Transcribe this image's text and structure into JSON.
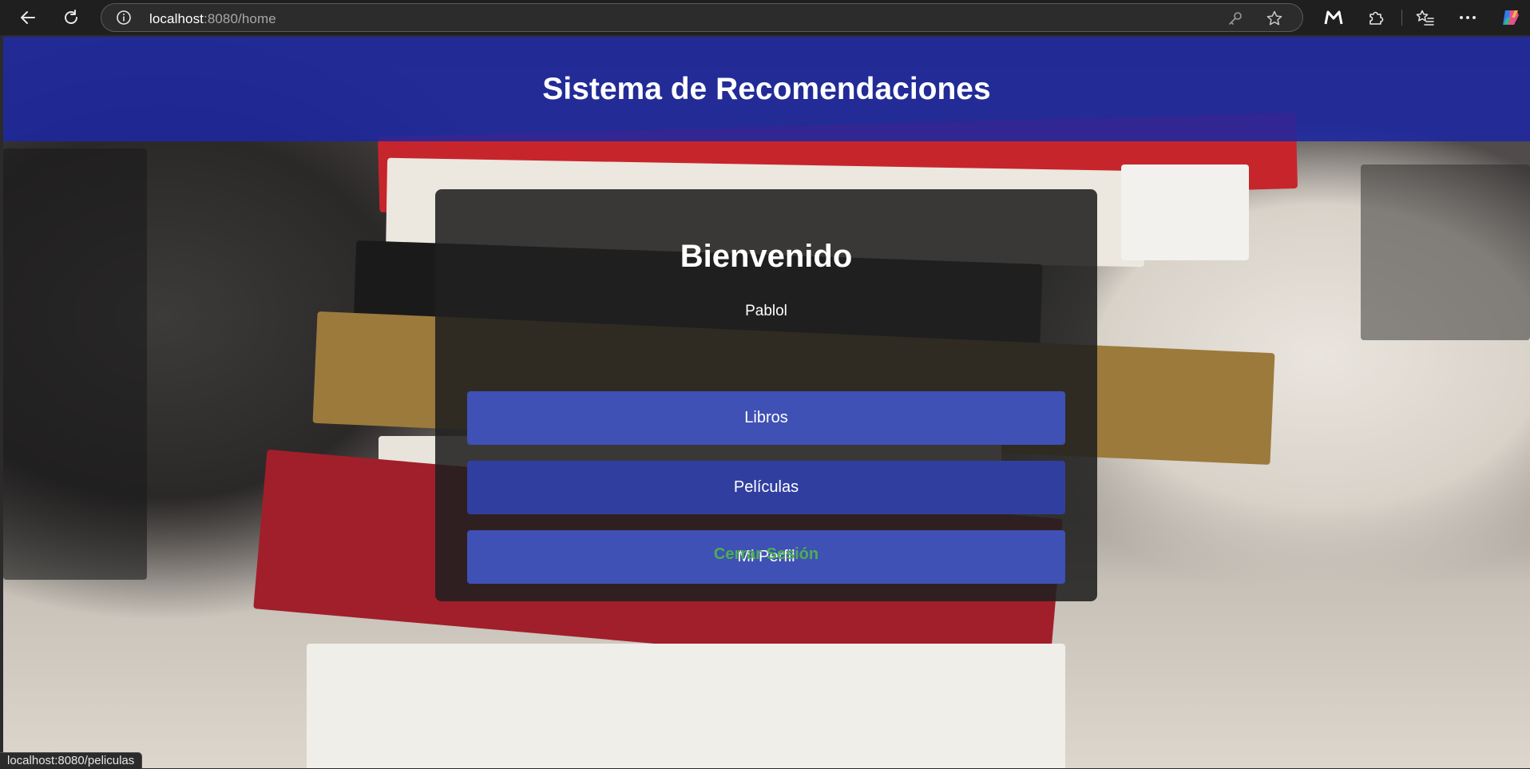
{
  "browser": {
    "url_host": "localhost",
    "url_path": ":8080/home",
    "status_url": "localhost:8080/peliculas"
  },
  "header": {
    "title": "Sistema de Recomendaciones"
  },
  "card": {
    "welcome": "Bienvenido",
    "username": "Pablol",
    "buttons": {
      "books": "Libros",
      "movies": "Películas",
      "profile": "Mi Perfil"
    },
    "logout": "Cerrar Sesión"
  },
  "colors": {
    "header_bg": "#1c27a0",
    "button_bg": "#3f51b5",
    "button_hover_bg": "#303f9f",
    "logout_link": "#4caf50",
    "card_bg": "#202020"
  },
  "icons": {
    "back": "back-arrow-icon",
    "reload": "reload-icon",
    "info": "info-icon",
    "key": "key-icon",
    "favorite": "star-icon",
    "extension_m": "m-extension-icon",
    "extensions": "puzzle-icon",
    "favorites": "favorites-list-icon",
    "menu": "more-icon",
    "copilot": "copilot-icon"
  }
}
